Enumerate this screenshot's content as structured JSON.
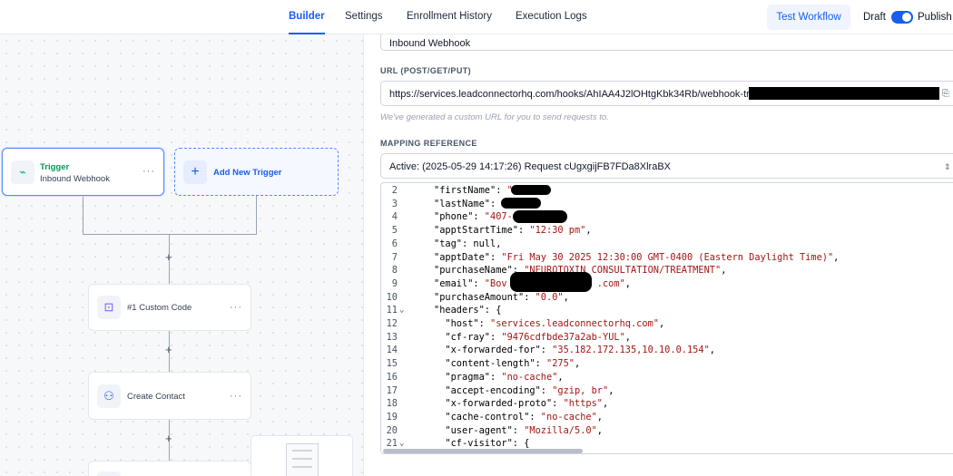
{
  "topbar": {
    "tabs": [
      "Builder",
      "Settings",
      "Enrollment History",
      "Execution Logs"
    ],
    "test_label": "Test Workflow",
    "draft_label": "Draft",
    "publish_label": "Publish"
  },
  "workflow": {
    "trigger": {
      "title": "Trigger",
      "subtitle": "Inbound Webhook"
    },
    "add_trigger": "Add New Trigger",
    "action1": "#1 Custom Code",
    "action2": "Create Contact",
    "plus": "+",
    "more": "···"
  },
  "panel": {
    "name_value": "Inbound Webhook",
    "url_label": "URL (POST/GET/PUT)",
    "url_value": "https://services.leadconnectorhq.com/hooks/AhIAA4J2lOHtgKbk34Rb/webhook-tr",
    "url_hint": "We've generated a custom URL for you to send requests to.",
    "mapping_label": "MAPPING REFERENCE",
    "mapping_value": "Active: (2025-05-29 14:17:26) Request cUgxgijFB7FDa8XlraBX"
  },
  "code_lines": [
    {
      "n": "2",
      "fold": "",
      "k": "\"firstName\": ",
      "v": "\"",
      "tail": ""
    },
    {
      "n": "3",
      "fold": "",
      "k": "\"lastName\": ",
      "v": "\"",
      "tail": ","
    },
    {
      "n": "4",
      "fold": "",
      "k": "\"phone\": ",
      "v": "\"407-",
      "tail": ","
    },
    {
      "n": "5",
      "fold": "",
      "k": "\"apptStartTime\": ",
      "v": "\"12:30 pm\"",
      "tail": ","
    },
    {
      "n": "6",
      "fold": "",
      "k": "\"tag\": ",
      "v": "",
      "tail": "null,"
    },
    {
      "n": "7",
      "fold": "",
      "k": "\"apptDate\": ",
      "v": "\"Fri May 30 2025 12:30:00 GMT-0400 (Eastern Daylight Time)\"",
      "tail": ","
    },
    {
      "n": "8",
      "fold": "",
      "k": "\"purchaseName\": ",
      "v": "\"NEUROTOXIN CONSULTATION/TREATMENT\"",
      "tail": ","
    },
    {
      "n": "9",
      "fold": "",
      "k": "\"email\": ",
      "v": "\"Bov                .com\"",
      "tail": ","
    },
    {
      "n": "10",
      "fold": "",
      "k": "\"purchaseAmount\": ",
      "v": "\"0.0\"",
      "tail": ","
    },
    {
      "n": "11",
      "fold": "⌄",
      "k": "\"headers\": ",
      "v": "",
      "tail": "{"
    },
    {
      "n": "12",
      "fold": "",
      "k": "  \"host\": ",
      "v": "\"services.leadconnectorhq.com\"",
      "tail": ","
    },
    {
      "n": "13",
      "fold": "",
      "k": "  \"cf-ray\": ",
      "v": "\"9476cdfbde37a2ab-YUL\"",
      "tail": ","
    },
    {
      "n": "14",
      "fold": "",
      "k": "  \"x-forwarded-for\": ",
      "v": "\"35.182.172.135,10.10.0.154\"",
      "tail": ","
    },
    {
      "n": "15",
      "fold": "",
      "k": "  \"content-length\": ",
      "v": "\"275\"",
      "tail": ","
    },
    {
      "n": "16",
      "fold": "",
      "k": "  \"pragma\": ",
      "v": "\"no-cache\"",
      "tail": ","
    },
    {
      "n": "17",
      "fold": "",
      "k": "  \"accept-encoding\": ",
      "v": "\"gzip, br\"",
      "tail": ","
    },
    {
      "n": "18",
      "fold": "",
      "k": "  \"x-forwarded-proto\": ",
      "v": "\"https\"",
      "tail": ","
    },
    {
      "n": "19",
      "fold": "",
      "k": "  \"cache-control\": ",
      "v": "\"no-cache\"",
      "tail": ","
    },
    {
      "n": "20",
      "fold": "",
      "k": "  \"user-agent\": ",
      "v": "\"Mozilla/5.0\"",
      "tail": ","
    },
    {
      "n": "21",
      "fold": "⌄",
      "k": "  \"cf-visitor\": ",
      "v": "",
      "tail": "{"
    }
  ]
}
